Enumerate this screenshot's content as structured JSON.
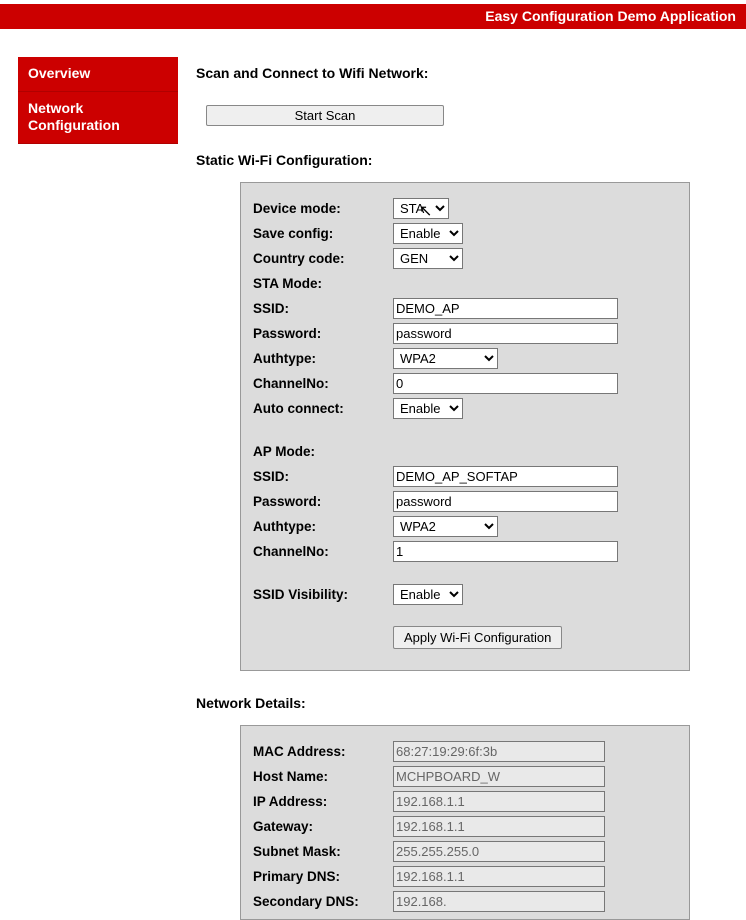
{
  "app_title": "Easy Configuration Demo Application",
  "sidebar": {
    "items": [
      {
        "label": "Overview"
      },
      {
        "label": "Network Configuration"
      }
    ]
  },
  "sections": {
    "scan_title": "Scan and Connect to Wifi Network:",
    "scan_button": "Start Scan",
    "static_title": "Static Wi-Fi Configuration:",
    "network_title": "Network Details:"
  },
  "wifi": {
    "device_mode_label": "Device mode:",
    "device_mode_value": "STA",
    "save_config_label": "Save config:",
    "save_config_value": "Enable",
    "country_label": "Country code:",
    "country_value": "GEN",
    "sta_mode_label": "STA Mode:",
    "sta_ssid_label": "SSID:",
    "sta_ssid_value": "DEMO_AP",
    "sta_password_label": "Password:",
    "sta_password_value": "password",
    "sta_auth_label": "Authtype:",
    "sta_auth_value": "WPA2",
    "sta_channel_label": "ChannelNo:",
    "sta_channel_value": "0",
    "auto_connect_label": "Auto connect:",
    "auto_connect_value": "Enable",
    "ap_mode_label": "AP Mode:",
    "ap_ssid_label": "SSID:",
    "ap_ssid_value": "DEMO_AP_SOFTAP",
    "ap_password_label": "Password:",
    "ap_password_value": "password",
    "ap_auth_label": "Authtype:",
    "ap_auth_value": "WPA2",
    "ap_channel_label": "ChannelNo:",
    "ap_channel_value": "1",
    "ssid_vis_label": "SSID Visibility:",
    "ssid_vis_value": "Enable",
    "apply_button": "Apply Wi-Fi Configuration"
  },
  "network": {
    "mac_label": "MAC Address:",
    "mac_value": "68:27:19:29:6f:3b",
    "host_label": "Host Name:",
    "host_value": "MCHPBOARD_W",
    "ip_label": "IP Address:",
    "ip_value": "192.168.1.1",
    "gateway_label": "Gateway:",
    "gateway_value": "192.168.1.1",
    "subnet_label": "Subnet Mask:",
    "subnet_value": "255.255.255.0",
    "pdns_label": "Primary DNS:",
    "pdns_value": "192.168.1.1",
    "sdns_label": "Secondary DNS:",
    "sdns_value": "192.168."
  }
}
